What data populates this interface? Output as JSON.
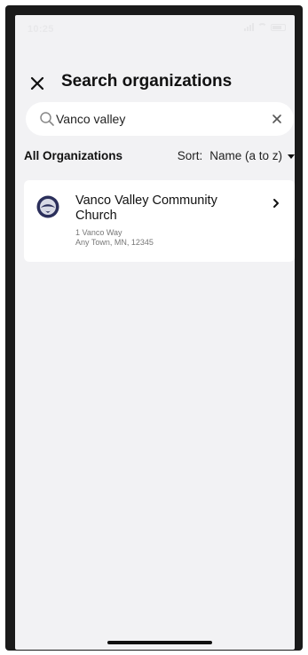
{
  "status_bar": {
    "time": "10:25"
  },
  "header": {
    "title": "Search organizations"
  },
  "search": {
    "value": "Vanco valley",
    "placeholder": ""
  },
  "list": {
    "heading": "All Organizations",
    "sort_label": "Sort:",
    "sort_value": "Name (a to z)"
  },
  "results": [
    {
      "name": "Vanco Valley Community Church",
      "address_line1": "1 Vanco Way",
      "address_line2": "Any Town, MN, 12345"
    }
  ],
  "colors": {
    "background": "#f2f2f4",
    "card": "#ffffff",
    "text": "#111111",
    "muted": "#777777",
    "logo_navy": "#2b2f5b"
  }
}
